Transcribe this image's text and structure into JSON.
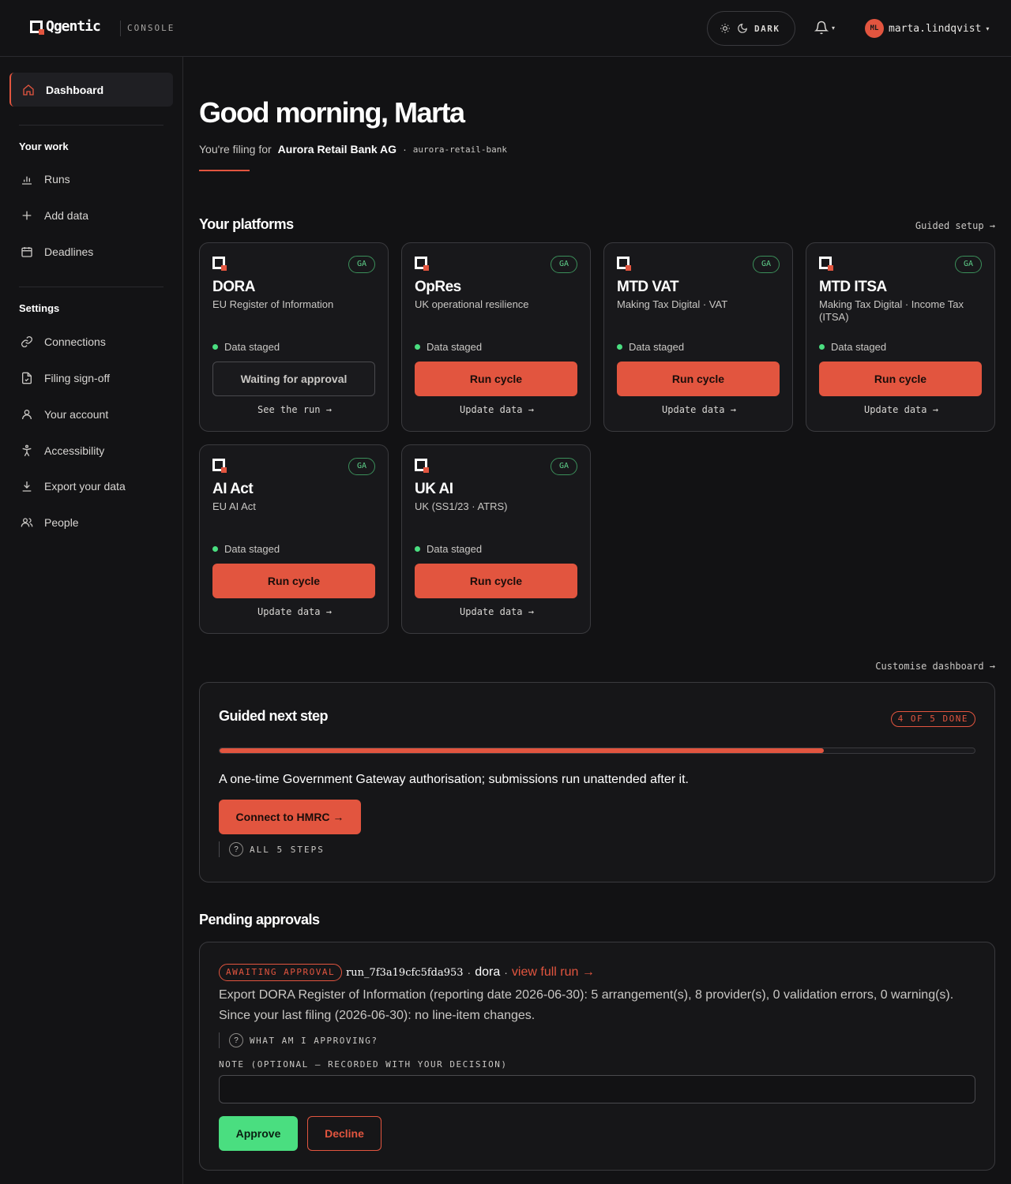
{
  "header": {
    "brand": "Qgentic",
    "console_label": "CONSOLE",
    "theme_label": "DARK",
    "user_initials": "ML",
    "user_name": "marta.lindqvist"
  },
  "sidebar": {
    "active": "Dashboard",
    "work_heading": "Your work",
    "work_items": [
      "Runs",
      "Add data",
      "Deadlines"
    ],
    "settings_heading": "Settings",
    "settings_items": [
      "Connections",
      "Filing sign-off",
      "Your account",
      "Accessibility",
      "Export your data",
      "People"
    ]
  },
  "greeting": {
    "title": "Good morning, Marta",
    "filing_prefix": "You're filing for",
    "org_name": "Aurora Retail Bank AG",
    "separator": "·",
    "org_slug": "aurora-retail-bank"
  },
  "platforms": {
    "title": "Your platforms",
    "guided_setup": "Guided setup →",
    "customise": "Customise dashboard →",
    "cards": [
      {
        "name": "DORA",
        "subtitle": "EU Register of Information",
        "badge": "GA",
        "status": "Data staged",
        "action": "Waiting for approval",
        "link": "See the run →"
      },
      {
        "name": "OpRes",
        "subtitle": "UK operational resilience",
        "badge": "GA",
        "status": "Data staged",
        "action": "Run cycle",
        "link": "Update data →"
      },
      {
        "name": "MTD VAT",
        "subtitle": "Making Tax Digital · VAT",
        "badge": "GA",
        "status": "Data staged",
        "action": "Run cycle",
        "link": "Update data →"
      },
      {
        "name": "MTD ITSA",
        "subtitle": "Making Tax Digital · Income Tax (ITSA)",
        "badge": "GA",
        "status": "Data staged",
        "action": "Run cycle",
        "link": "Update data →"
      },
      {
        "name": "AI Act",
        "subtitle": "EU AI Act",
        "badge": "GA",
        "status": "Data staged",
        "action": "Run cycle",
        "link": "Update data →"
      },
      {
        "name": "UK AI",
        "subtitle": "UK (SS1/23 · ATRS)",
        "badge": "GA",
        "status": "Data staged",
        "action": "Run cycle",
        "link": "Update data →"
      }
    ]
  },
  "guided": {
    "title": "Guided next step",
    "steps_badge": "4 OF 5 DONE",
    "progress": 0.8,
    "description": "A one-time Government Gateway authorisation; submissions run unattended after it.",
    "button": "Connect to HMRC →",
    "help": "ALL 5 STEPS"
  },
  "approvals": {
    "title": "Pending approvals",
    "status": "AWAITING APPROVAL",
    "run_id": "run_7f3a19cfc5fda953",
    "dot": "·",
    "platform": "dora",
    "view_run": "view full run →",
    "text": "Export DORA Register of Information (reporting date 2026-06-30): 5 arrangement(s), 8 provider(s), 0 validation errors, 0 warning(s). Since your last filing (2026-06-30): no line-item changes.",
    "help": "WHAT AM I APPROVING?",
    "note_label": "NOTE (OPTIONAL — RECORDED WITH YOUR DECISION)",
    "note_value": "",
    "approve": "Approve",
    "decline": "Decline"
  },
  "colors": {
    "accent": "#e2553f",
    "success": "#4ade80",
    "background": "#121214"
  }
}
